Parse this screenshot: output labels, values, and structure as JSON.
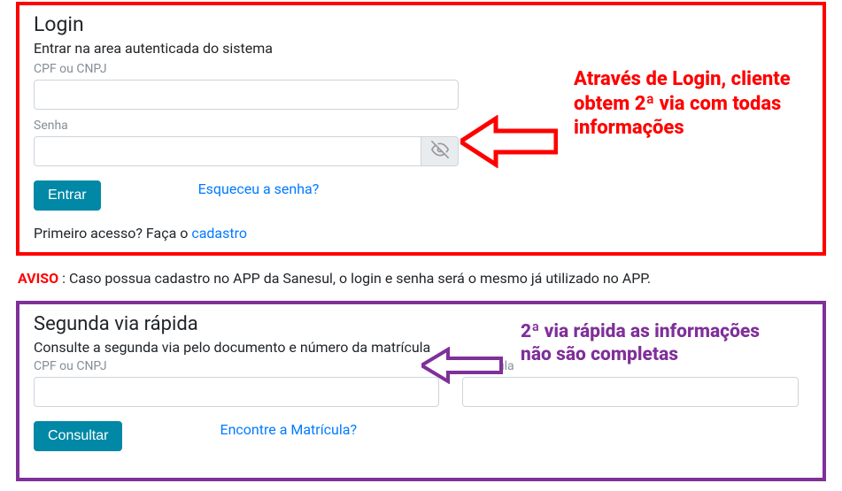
{
  "login": {
    "title": "Login",
    "subtitle": "Entrar na area autenticada do sistema",
    "cpf_label": "CPF ou CNPJ",
    "senha_label": "Senha",
    "submit_label": "Entrar",
    "forgot_label": "Esqueceu a senha?",
    "first_access_prefix": "Primeiro acesso? Faça o ",
    "first_access_link": "cadastro"
  },
  "notice": {
    "strong": "AVISO",
    "text": " : Caso possua cadastro no APP da Sanesul, o login e senha será o mesmo já utilizado no APP."
  },
  "quick": {
    "title": "Segunda via rápida",
    "subtitle": "Consulte a segunda via pelo documento e número da matrícula",
    "cpf_label": "CPF ou CNPJ",
    "matricula_label": "Matricula",
    "submit_label": "Consultar",
    "find_label": "Encontre a Matrícula?"
  },
  "callouts": {
    "red": "Através de Login, cliente obtem 2ª via com todas informações",
    "purple": "2ª via rápida as informações não são completas"
  },
  "colors": {
    "red": "#ff0000",
    "purple": "#7f3099",
    "primary_btn": "#0088a6",
    "link": "#007bff"
  }
}
